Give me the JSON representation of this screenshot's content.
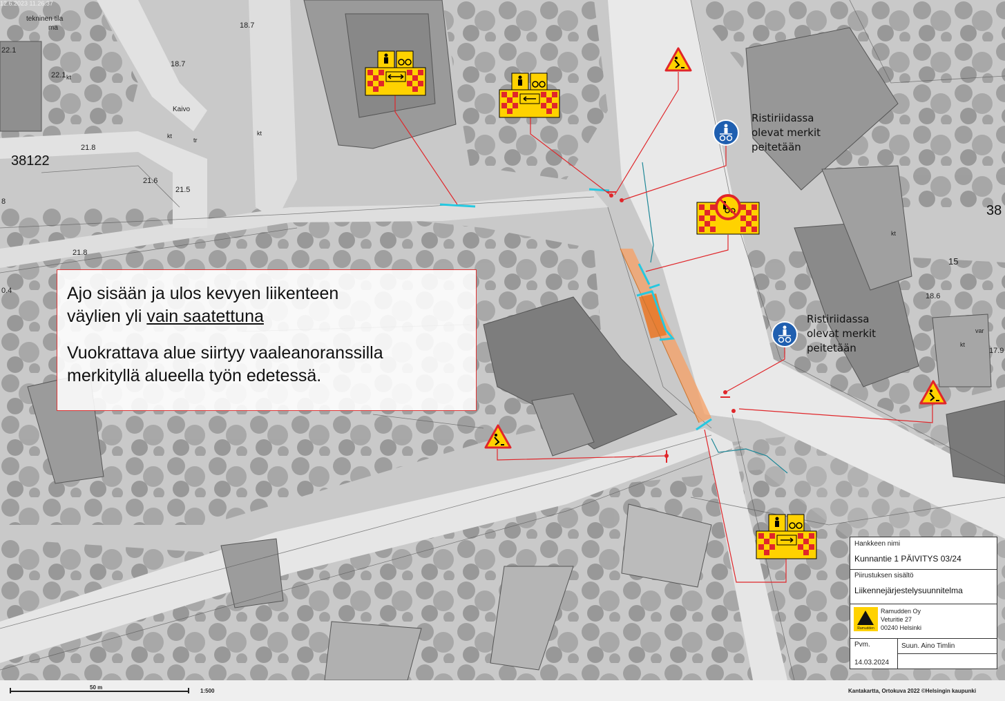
{
  "timestamp": "12.6.2023 11.26.37",
  "map_labels": [
    {
      "text": "tekninen tila"
    },
    {
      "text": "ma"
    },
    {
      "text": "22.1"
    },
    {
      "text": "22.1"
    },
    {
      "text": "kt"
    },
    {
      "text": "18.7"
    },
    {
      "text": "18.7"
    },
    {
      "text": "Kaivo"
    },
    {
      "text": "kt"
    },
    {
      "text": "tr"
    },
    {
      "text": "kt"
    },
    {
      "text": "38122"
    },
    {
      "text": "21.8"
    },
    {
      "text": "21.6"
    },
    {
      "text": "21.5"
    },
    {
      "text": "8"
    },
    {
      "text": "21.8"
    },
    {
      "text": "0.4"
    },
    {
      "text": "38"
    },
    {
      "text": "kt"
    },
    {
      "text": "15"
    },
    {
      "text": "18.6"
    },
    {
      "text": "kt"
    },
    {
      "text": "var"
    },
    {
      "text": "17.9"
    }
  ],
  "note": {
    "line1": "Ajo sisään ja ulos kevyen liikenteen",
    "line2_prefix": "väylien yli ",
    "line2_underlined": "vain saatettuna",
    "line3": "Vuokrattava alue siirtyy vaaleanoranssilla",
    "line4": "merkityllä alueella työn edetessä."
  },
  "sign_notes": [
    {
      "l1": "Ristiriidassa",
      "l2": "olevat merkit",
      "l3": "peitetään"
    },
    {
      "l1": "Ristiriidassa",
      "l2": "olevat merkit",
      "l3": "peitetään"
    }
  ],
  "signs": [
    {
      "icon": "pedestrian-bicycle-barrier-sign-icon"
    },
    {
      "icon": "pedestrian-bicycle-barrier-sign-icon"
    },
    {
      "icon": "roadworks-warning-sign-icon"
    },
    {
      "icon": "pedestrian-bicycle-route-sign-icon"
    },
    {
      "icon": "no-pedestrians-cyclists-barrier-sign-icon"
    },
    {
      "icon": "pedestrian-bicycle-route-sign-icon"
    },
    {
      "icon": "roadworks-warning-sign-icon"
    },
    {
      "icon": "roadworks-warning-sign-icon"
    },
    {
      "icon": "pedestrian-bicycle-barrier-sign-icon"
    }
  ],
  "title_block": {
    "project_label": "Hankkeen nimi",
    "project_value": "Kunnantie 1 PÄIVITYS 03/24",
    "content_label": "Piirustuksen sisältö",
    "content_value": "Liikennejärjestelysuunnitelma",
    "company_name": "Ramudden Oy",
    "company_street": "Veturitie 27",
    "company_city": "00240 Helsinki",
    "logo_text": "Ramudden",
    "date_label": "Pvm.",
    "designer": "Suun. Aino Timlin",
    "date_value": "14.03.2024"
  },
  "footer": {
    "scale_distance": "50 m",
    "scale_ratio": "1:500",
    "credit": "Kantakartta, Ortokuva 2022 ©Helsingin kaupunki"
  },
  "colors": {
    "leader_line": "#e0262a",
    "barrier_cyan": "#25c8e0",
    "work_area_orange": "#f5a36a",
    "sign_yellow": "#ffd200",
    "sign_blue": "#1f5fb0"
  }
}
